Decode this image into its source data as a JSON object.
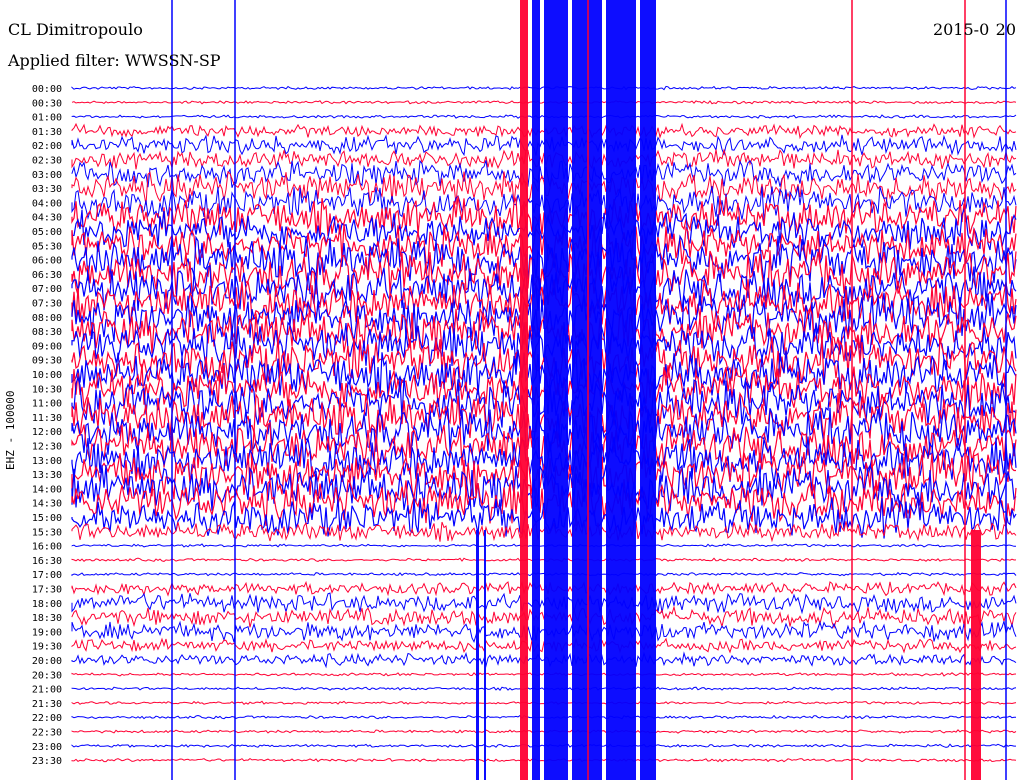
{
  "header": {
    "station": "CL Dimitropoulo",
    "filter": "Applied filter: WWSSN-SP",
    "date": "2015-0  20"
  },
  "channel_label": "EHZ - 100000",
  "chart_data": {
    "type": "line",
    "title": "CL Dimitropoulo",
    "subtitle": "Applied filter: WWSSN-SP",
    "ylabel": "EHZ - 100000",
    "xlabel": "",
    "categories": [
      "00:00",
      "00:30",
      "01:00",
      "01:30",
      "02:00",
      "02:30",
      "03:00",
      "03:30",
      "04:00",
      "04:30",
      "05:00",
      "05:30",
      "06:00",
      "06:30",
      "07:00",
      "07:30",
      "08:00",
      "08:30",
      "09:00",
      "09:30",
      "10:00",
      "10:30",
      "11:00",
      "11:30",
      "12:00",
      "12:30",
      "13:00",
      "13:30",
      "14:00",
      "14:30",
      "15:00",
      "15:30",
      "16:00",
      "16:30",
      "17:00",
      "17:30",
      "18:00",
      "18:30",
      "19:00",
      "19:30",
      "20:00",
      "20:30",
      "21:00",
      "21:30",
      "22:00",
      "22:30",
      "23:00",
      "23:30"
    ],
    "series_colors": [
      "#0000ff",
      "#ff0033"
    ],
    "activity_level": [
      1,
      1,
      1,
      2,
      3,
      3,
      4,
      5,
      5,
      6,
      6,
      6,
      7,
      7,
      7,
      7,
      7,
      7,
      7,
      7,
      7,
      7,
      7,
      7,
      7,
      7,
      7,
      7,
      7,
      7,
      6,
      3,
      1,
      1,
      1,
      2,
      3,
      3,
      3,
      2,
      2,
      1,
      1,
      1,
      1,
      1,
      1,
      1
    ],
    "grid": false,
    "legend": "none"
  }
}
